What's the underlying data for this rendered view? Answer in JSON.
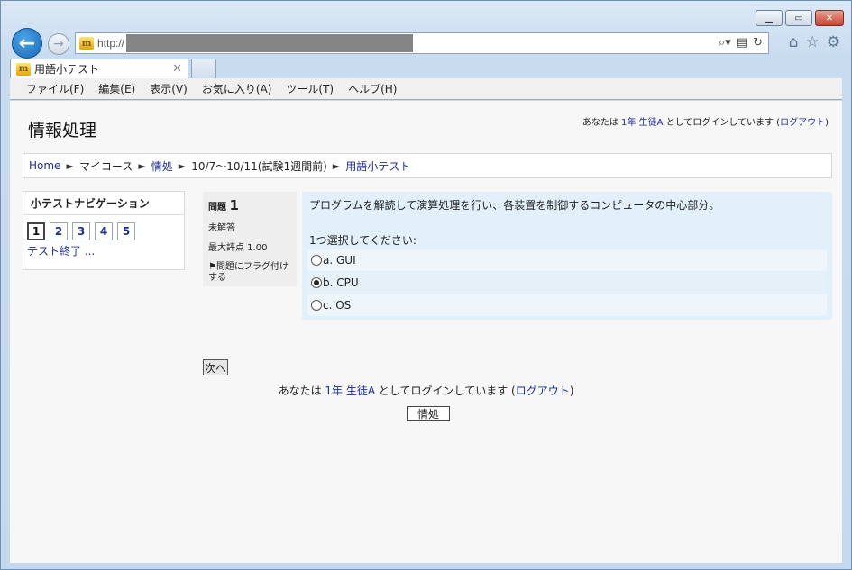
{
  "browser": {
    "url_prefix": "http://",
    "tab_title": "用語小テスト",
    "menu": [
      "ファイル(F)",
      "編集(E)",
      "表示(V)",
      "お気に入り(A)",
      "ツール(T)",
      "ヘルプ(H)"
    ]
  },
  "page": {
    "site_title": "情報処理",
    "login_top": {
      "prefix": "あなたは ",
      "user": "1年 生徒A",
      "middle": " としてログインしています (",
      "logout": "ログアウト",
      "suffix": ")"
    },
    "breadcrumb": [
      "Home",
      "マイコース",
      "情処",
      "10/7〜10/11(試験1週間前)",
      "用語小テスト"
    ],
    "breadcrumb_sep": "►",
    "quiz_nav": {
      "title": "小テストナビゲーション",
      "buttons": [
        "1",
        "2",
        "3",
        "4",
        "5"
      ],
      "finish": "テスト終了 ..."
    },
    "question": {
      "label": "問題",
      "number": "1",
      "state": "未解答",
      "max_score": "最大評点 1.00",
      "flag": "問題にフラグ付けする",
      "text": "プログラムを解読して演算処理を行い、各装置を制御するコンピュータの中心部分。",
      "prompt": "1つ選択してください:",
      "answers": [
        {
          "label": "a. GUI",
          "checked": false
        },
        {
          "label": "b. CPU",
          "checked": true
        },
        {
          "label": "c. OS",
          "checked": false
        }
      ]
    },
    "next_button": "次へ",
    "login_bottom": {
      "prefix": "あなたは ",
      "user": "1年 生徒A",
      "middle": " としてログインしています (",
      "logout": "ログアウト",
      "suffix": ")"
    },
    "home_button": "情処"
  }
}
